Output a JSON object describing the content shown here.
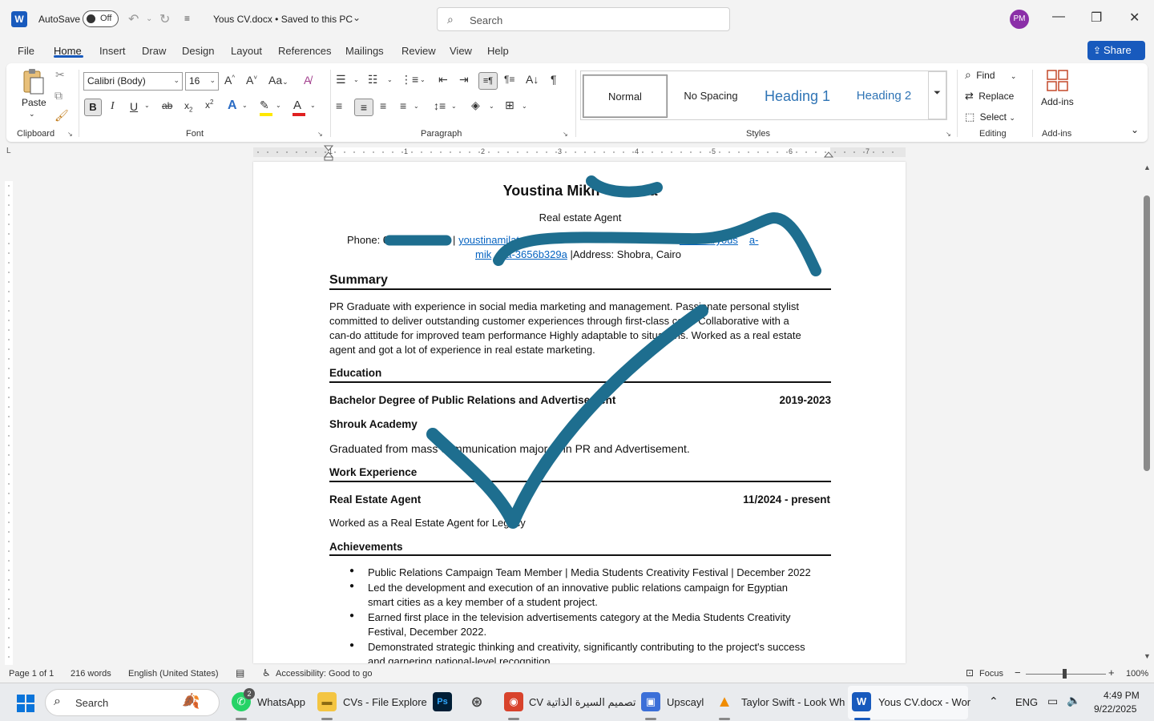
{
  "app": {
    "autosave_label": "AutoSave",
    "autosave_state": "Off",
    "doc_title": "Yous CV.docx • Saved to this PC",
    "search_placeholder": "Search",
    "avatar_initials": "PM"
  },
  "menu": {
    "tabs": [
      "File",
      "Home",
      "Insert",
      "Draw",
      "Design",
      "Layout",
      "References",
      "Mailings",
      "Review",
      "View",
      "Help"
    ],
    "active": "Home",
    "share_label": "Share"
  },
  "ribbon": {
    "clipboard": {
      "paste_label": "Paste",
      "group_label": "Clipboard"
    },
    "font": {
      "font_name": "Calibri (Body)",
      "font_size": "16",
      "group_label": "Font"
    },
    "paragraph": {
      "group_label": "Paragraph"
    },
    "styles": {
      "items": [
        "Normal",
        "No Spacing",
        "Heading 1",
        "Heading 2"
      ],
      "group_label": "Styles"
    },
    "editing": {
      "find_label": "Find",
      "replace_label": "Replace",
      "select_label": "Select",
      "group_label": "Editing"
    },
    "addins": {
      "label": "Add-ins",
      "group_label": "Add-ins"
    }
  },
  "ruler": {
    "numbers": [
      "1",
      "1",
      "2",
      "3",
      "4",
      "5",
      "6",
      "7"
    ]
  },
  "document": {
    "name": "Youstina Mikh",
    "name_tail": "a",
    "role": "Real estate Agent",
    "contact_phone_label": "Phone: 0",
    "contact_sep": "|",
    "contact_link1": "youstinami",
    "contact_link1b": "lat",
    "contact_link2": ".com/in/yous",
    "contact_link2b": "a-",
    "contact_line2_link_a": "mik",
    "contact_line2_link_b": "a-3656b329a",
    "contact_address": "|Address: Shobra, Cairo",
    "summary_heading": "Summary",
    "summary_lines": [
      "PR Graduate with experience in social media marketing and management. Passionate personal stylist",
      "committed to deliver outstanding customer experiences through first-class care. Collaborative with a",
      "can-do attitude for improved team performance Highly adaptable to situations. Worked as a real estate",
      "agent and got a lot of experience in real estate marketing."
    ],
    "education_heading": "Education",
    "degree": "Bachelor Degree of Public Relations and Advertisement",
    "degree_years": "2019-2023",
    "school": "Shrouk Academy",
    "edu_note": "Graduated from mass communication majored in PR and Advertisement.",
    "work_heading": "Work Experience",
    "job_title": "Real Estate Agent",
    "job_dates": "11/2024 - present",
    "job_desc": "Worked as a Real Estate Agent for Legacy",
    "achievements_heading": "Achievements",
    "achievements": [
      [
        "Public Relations Campaign Team Member | Media Students Creativity Festival | December 2022"
      ],
      [
        "Led the development and execution of an innovative public relations campaign for Egyptian",
        "smart cities as a key member of a student project."
      ],
      [
        "Earned first place in the television advertisements category at the Media Students Creativity",
        "Festival, December 2022."
      ],
      [
        "Demonstrated strategic thinking and creativity, significantly contributing to the project's success",
        "and garnering national-level recognition"
      ]
    ]
  },
  "status": {
    "page": "Page 1 of 1",
    "words": "216 words",
    "language": "English (United States)",
    "accessibility": "Accessibility: Good to go",
    "focus": "Focus",
    "zoom": "100%"
  },
  "taskbar": {
    "search_label": "Search",
    "whatsapp_badge": "2",
    "items": [
      "WhatsApp",
      "CVs - File Explore",
      "CV تصميم السيرة الذاتية",
      "Upscayl",
      "Taylor Swift - Look Wh",
      "Yous CV.docx - Wor"
    ],
    "lang": "ENG",
    "time": "4:49 PM",
    "date": "9/22/2025"
  },
  "colors": {
    "accent": "#185abd",
    "ink_overlay": "#1e6e8f",
    "link": "#0563c1"
  }
}
